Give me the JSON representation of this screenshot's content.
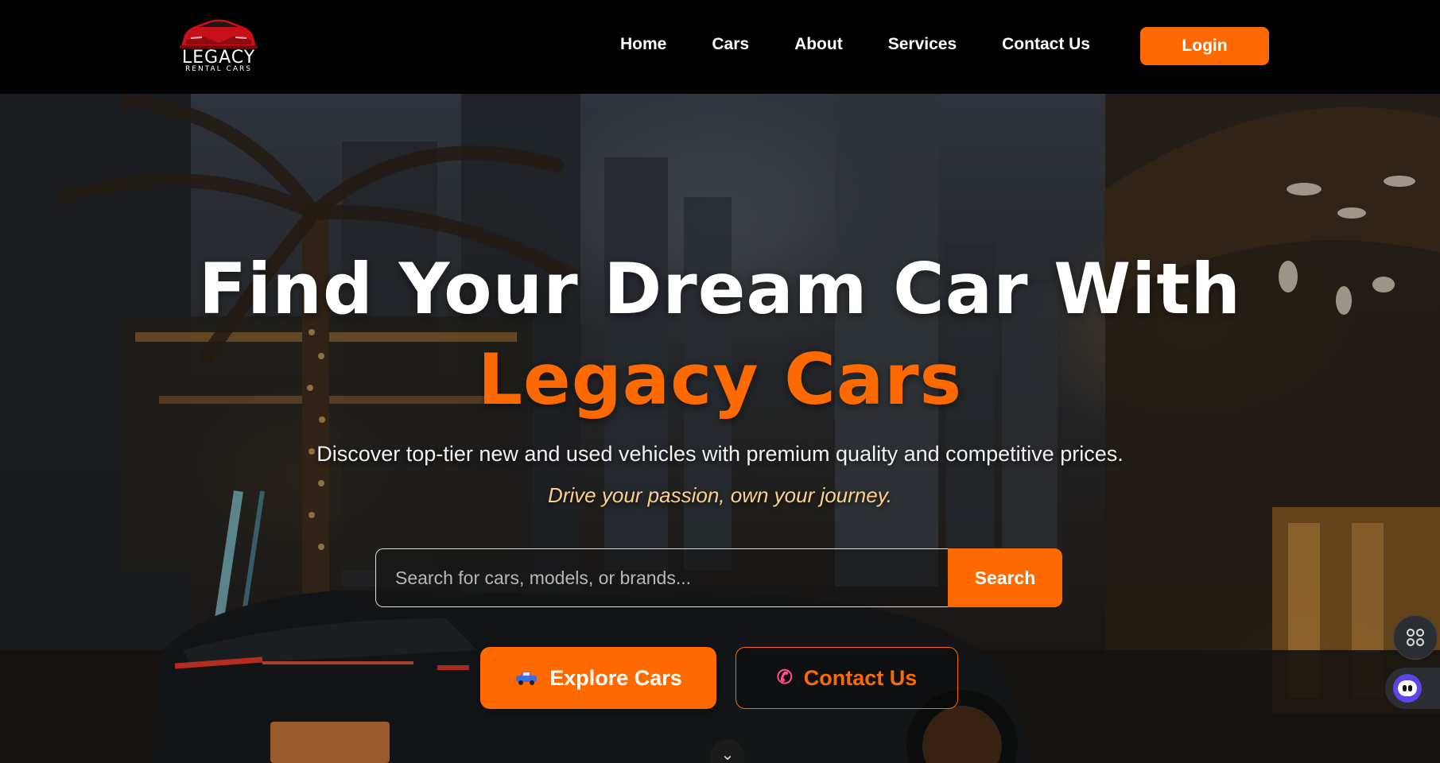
{
  "brand": {
    "name": "LEGACY",
    "subname": "RENTAL CARS",
    "accent_color": "#ff6a00"
  },
  "nav": {
    "links": [
      {
        "label": "Home"
      },
      {
        "label": "Cars"
      },
      {
        "label": "About"
      },
      {
        "label": "Services"
      },
      {
        "label": "Contact Us"
      }
    ],
    "login_label": "Login"
  },
  "hero": {
    "title_line1": "Find Your Dream Car With",
    "title_line2": "Legacy Cars",
    "subtitle": "Discover top-tier new and used vehicles with premium quality and competitive prices.",
    "tagline": "Drive your passion, own your journey.",
    "search": {
      "placeholder": "Search for cars, models, or brands...",
      "value": "",
      "button_label": "Search"
    },
    "cta_explore": {
      "label": "Explore Cars",
      "icon": "car-icon"
    },
    "cta_contact": {
      "label": "Contact Us",
      "icon": "phone-icon"
    },
    "scroll_icon": "chevron-down-icon"
  },
  "floating": {
    "apps_icon": "apps-grid-icon",
    "assistant_icon": "assistant-icon"
  }
}
